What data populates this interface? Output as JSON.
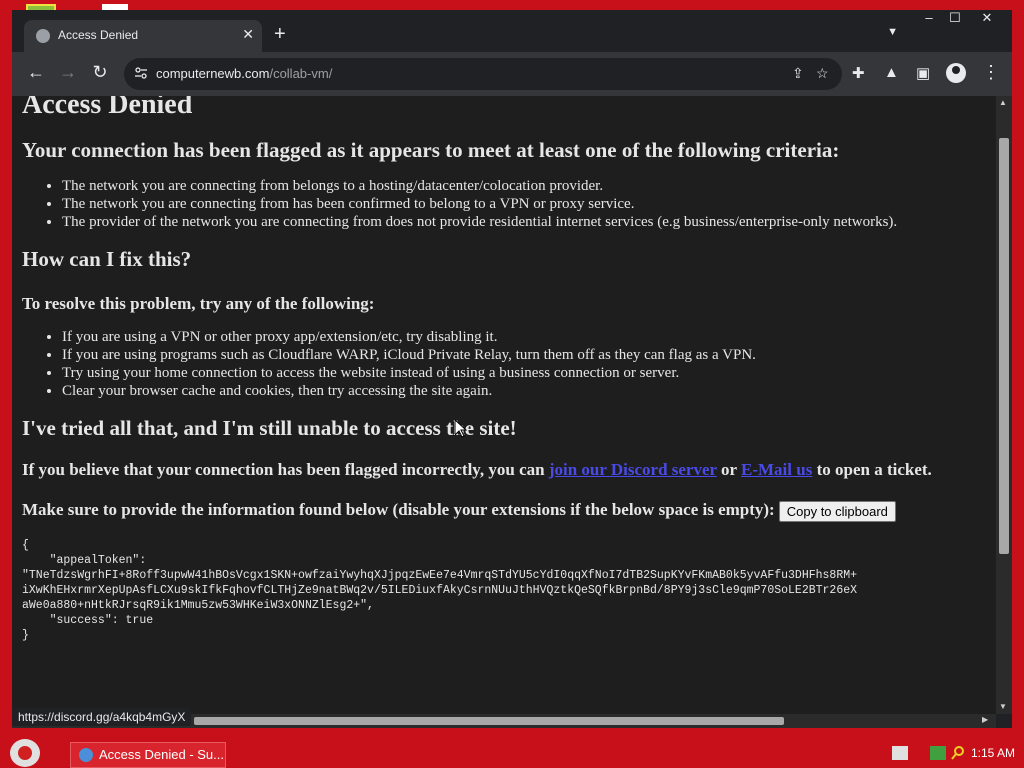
{
  "tab": {
    "title": "Access Denied"
  },
  "window_controls": {
    "minimize": "–",
    "maximize": "☐",
    "close": "✕"
  },
  "toolbar": {
    "url_domain": "computernewb.com",
    "url_path": "/collab-vm/"
  },
  "page": {
    "heading": "Access Denied",
    "criteria_heading": "Your connection has been flagged as it appears to meet at least one of the following criteria:",
    "criteria": [
      "The network you are connecting from belongs to a hosting/datacenter/colocation provider.",
      "The network you are connecting from has been confirmed to belong to a VPN or proxy service.",
      "The provider of the network you are connecting from does not provide residential internet services (e.g business/enterprise-only networks)."
    ],
    "fix_heading": "How can I fix this?",
    "resolve_heading": "To resolve this problem, try any of the following:",
    "fixes": [
      "If you are using a VPN or other proxy app/extension/etc, try disabling it.",
      "If you are using programs such as Cloudflare WARP, iCloud Private Relay, turn them off as they can flag as a VPN.",
      "Try using your home connection to access the website instead of using a business connection or server.",
      "Clear your browser cache and cookies, then try accessing the site again."
    ],
    "tried_heading": "I've tried all that, and I'm still unable to access the site!",
    "believe_prefix": "If you believe that your connection has been flagged incorrectly, you can ",
    "discord_link": "join our Discord server",
    "or_text": " or ",
    "email_link": "E-Mail us",
    "believe_suffix": " to open a ticket.",
    "provide_text": "Make sure to provide the information found below (disable your extensions if the below space is empty):",
    "copy_button": "Copy to clipboard",
    "token_block": "{\n    \"appealToken\":\n\"TNeTdzsWgrhFI+8Roff3upwW41hBOsVcgx1SKN+owfzaiYwyhqXJjpqzEwEe7e4VmrqSTdYU5cYdI0qqXfNoI7dTB2SupKYvFKmAB0k5yvAFfu3DHFhs8RM+\niXwKhEHxrmrXepUpAsfLCXu9skIfkFqhovfCLTHjZe9natBWq2v/5ILEDiuxfAkyCsrnNUuJthHVQztkQeSQfkBrpnBd/8PY9j3sCle9qmP70SoLE2BTr26eX\naWe0a880+nHtkRJrsqR9ik1Mmu5zw53WHKeiW3xONNZlEsg2+\",\n    \"success\": true\n}"
  },
  "status_bubble": "https://discord.gg/a4kqb4mGyX",
  "taskbar": {
    "task_label": "Access Denied - Su...",
    "clock": "1:15 AM"
  }
}
